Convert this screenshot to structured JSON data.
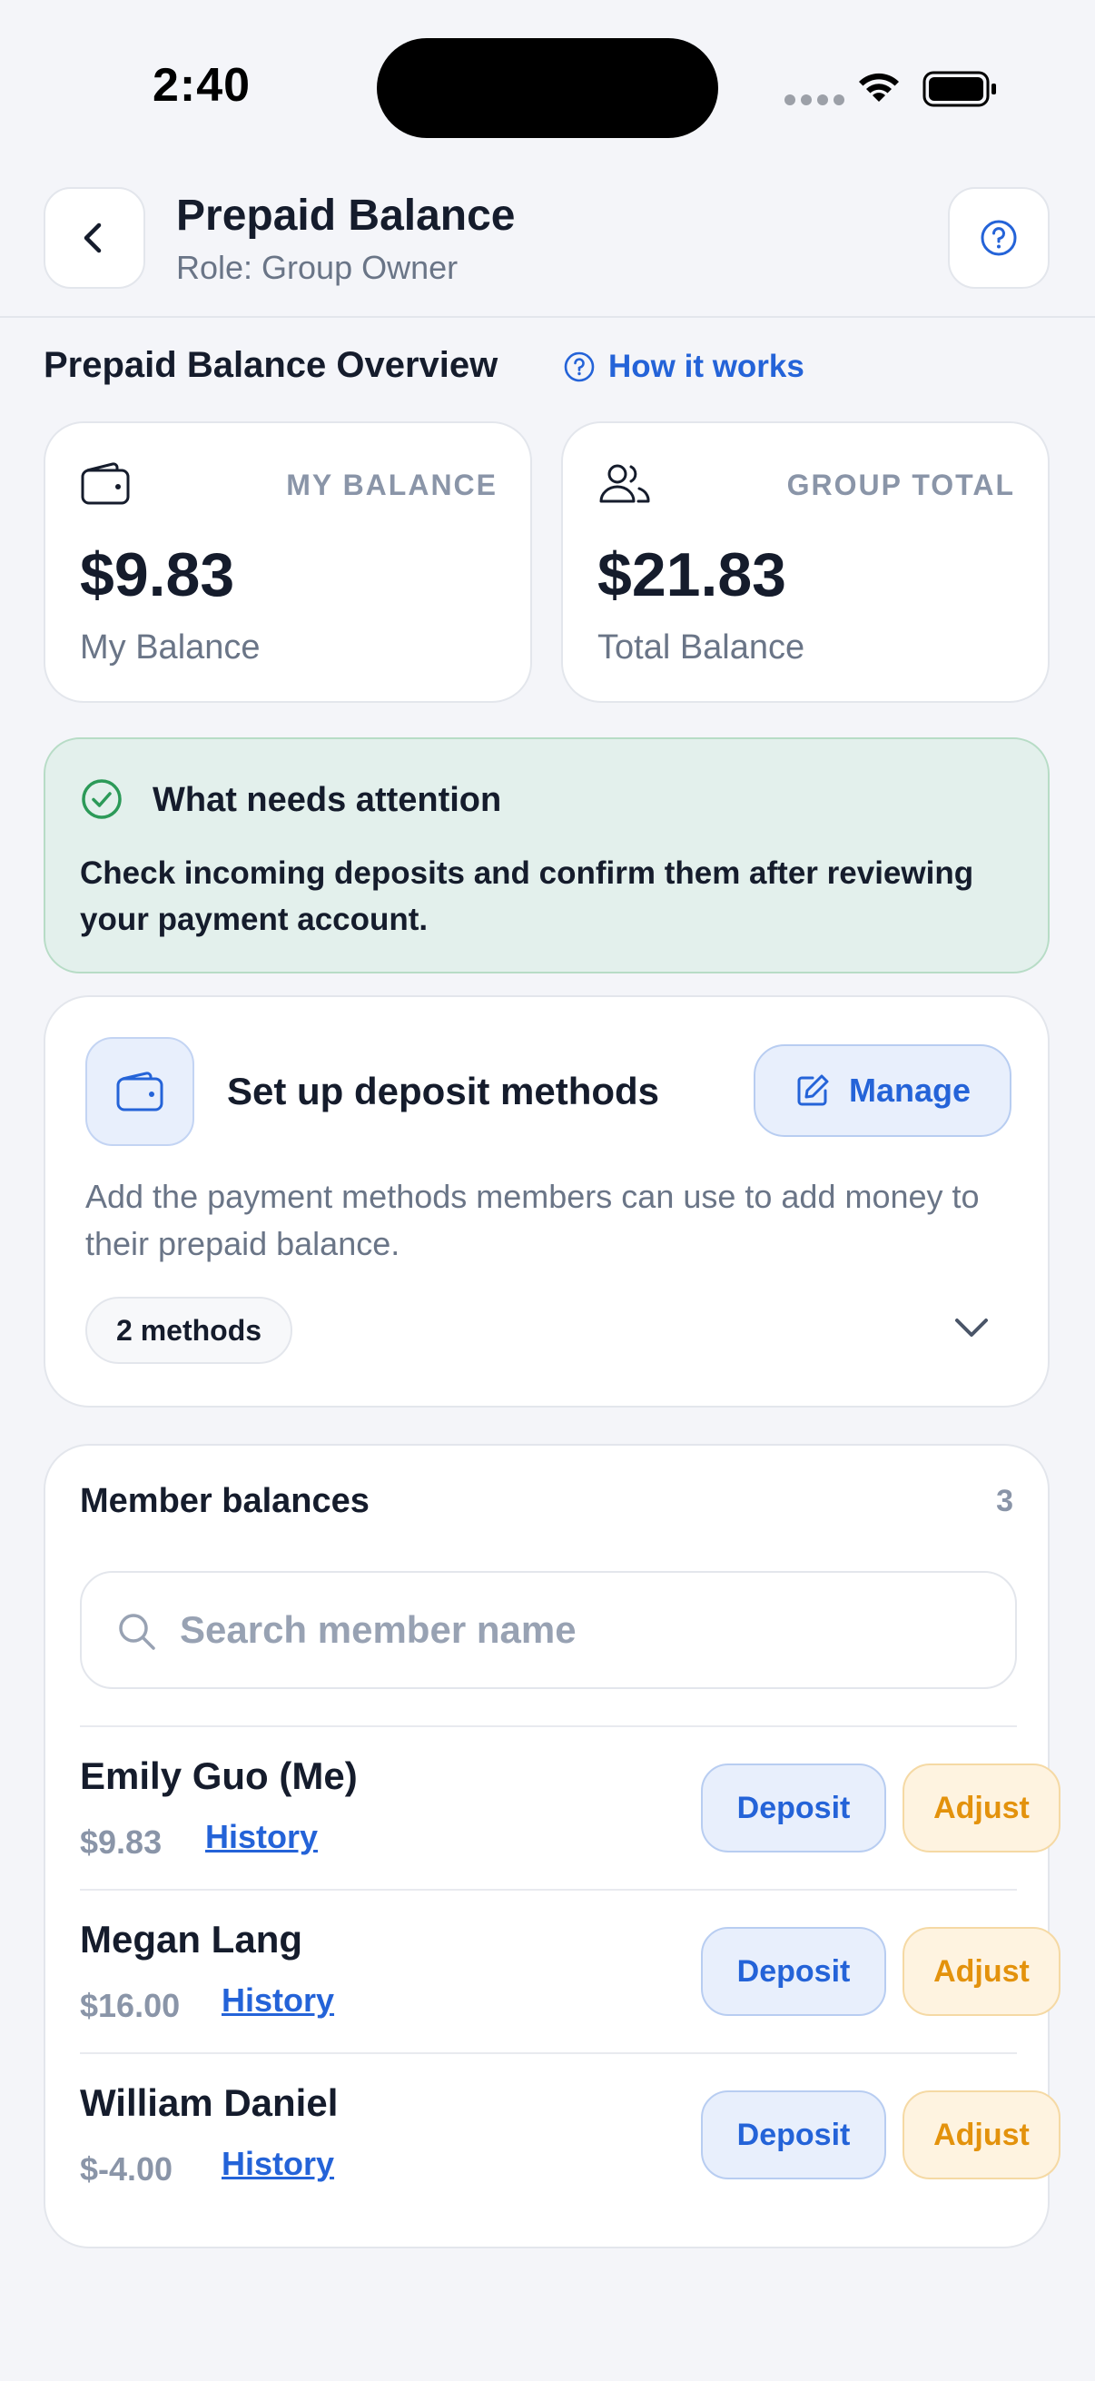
{
  "status_bar": {
    "time": "2:40"
  },
  "header": {
    "title": "Prepaid Balance",
    "subtitle": "Role: Group Owner"
  },
  "overview": {
    "title": "Prepaid Balance Overview",
    "how_it_works": "How it works"
  },
  "stats": [
    {
      "label": "MY BALANCE",
      "value": "$9.83",
      "sub": "My Balance",
      "icon": "wallet-icon"
    },
    {
      "label": "GROUP TOTAL",
      "value": "$21.83",
      "sub": "Total Balance",
      "icon": "users-icon"
    }
  ],
  "attention": {
    "title": "What needs attention",
    "body": "Check incoming deposits and confirm them after reviewing your payment account."
  },
  "deposit_methods": {
    "title": "Set up deposit methods",
    "manage_label": "Manage",
    "description": "Add the payment methods members can use to add money to their prepaid balance.",
    "methods_count": "2 methods"
  },
  "members": {
    "title": "Member balances",
    "count": "3",
    "search_placeholder": "Search member name",
    "deposit_label": "Deposit",
    "adjust_label": "Adjust",
    "history_label": "History",
    "rows": [
      {
        "name": "Emily Guo (Me)",
        "balance": "$9.83"
      },
      {
        "name": "Megan Lang",
        "balance": "$16.00"
      },
      {
        "name": "William Daniel",
        "balance": "$-4.00"
      }
    ]
  },
  "colors": {
    "accent": "#2463d8",
    "adjust": "#e3920c",
    "success": "#2c9a58",
    "background": "#f4f5f9"
  }
}
